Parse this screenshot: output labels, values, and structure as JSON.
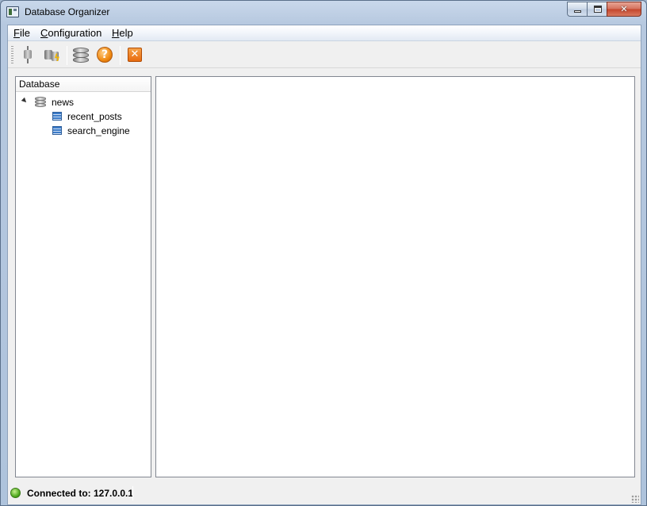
{
  "window": {
    "title": "Database Organizer",
    "controls": {
      "minimize": "minimize",
      "maximize": "maximize",
      "close": "close"
    }
  },
  "menubar": {
    "items": [
      {
        "accel": "F",
        "rest": "ile"
      },
      {
        "accel": "C",
        "rest": "onfiguration"
      },
      {
        "accel": "H",
        "rest": "elp"
      }
    ]
  },
  "toolbar": {
    "icons": [
      "connect-plug-icon",
      "disconnect-plug-icon",
      "database-icon",
      "help-icon",
      "close-x-icon"
    ]
  },
  "tree": {
    "header": "Database",
    "database": {
      "name": "news",
      "icon": "database-icon",
      "expanded": true
    },
    "tables": [
      {
        "name": "recent_posts",
        "icon": "table-icon"
      },
      {
        "name": "search_engine",
        "icon": "table-icon"
      }
    ]
  },
  "status": {
    "text": "Connected to: 127.0.0.1",
    "state_color": "#4aa61a"
  },
  "colors": {
    "titlebar": "#b6c8df",
    "close_button": "#c4442b",
    "toolbar_help": "#f08a12",
    "toolbar_close": "#e86b10"
  }
}
